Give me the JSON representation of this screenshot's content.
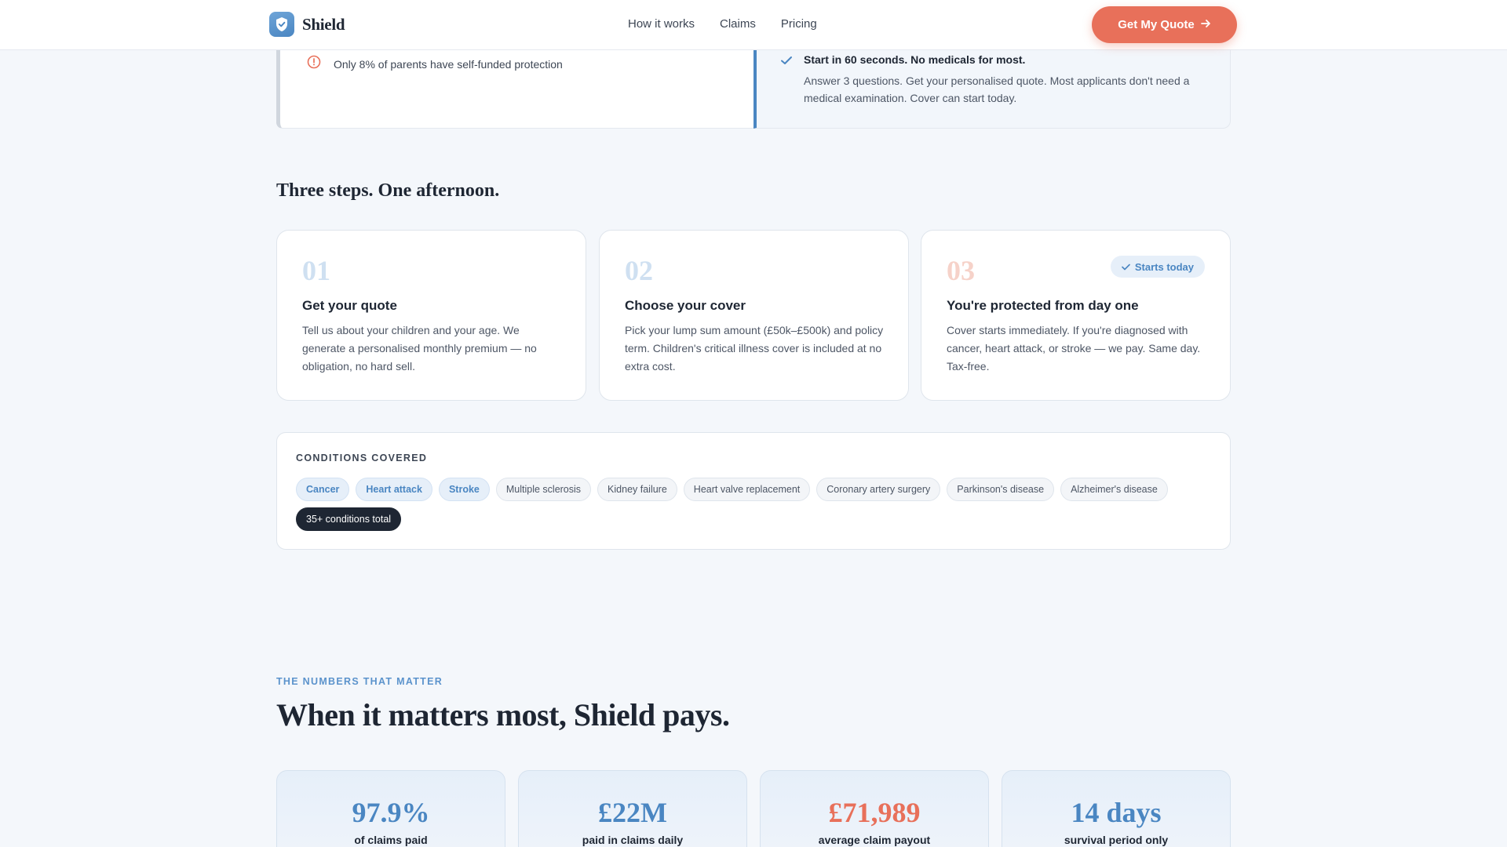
{
  "nav": {
    "brand": "Shield",
    "links": [
      "How it works",
      "Claims",
      "Pricing"
    ],
    "cta_label": "Get My Quote"
  },
  "top_cards": {
    "warning_text": "Only 8% of parents have self-funded protection",
    "check_title": "Start in 60 seconds. No medicals for most.",
    "check_desc": "Answer 3 questions. Get your personalised quote. Most applicants don't need a medical examination. Cover can start today."
  },
  "steps_section": {
    "title": "Three steps. One afternoon.",
    "steps": [
      {
        "num": "01",
        "title": "Get your quote",
        "desc": "Tell us about your children and your age. We generate a personalised monthly premium — no obligation, no hard sell."
      },
      {
        "num": "02",
        "title": "Choose your cover",
        "desc": "Pick your lump sum amount (£50k–£500k) and policy term. Children's critical illness cover is included at no extra cost."
      },
      {
        "num": "03",
        "title": "You're protected from day one",
        "desc": "Cover starts immediately. If you're diagnosed with cancer, heart attack, or stroke — we pay. Same day. Tax-free.",
        "badge": "Starts today"
      }
    ]
  },
  "conditions": {
    "label": "CONDITIONS COVERED",
    "chips": [
      "Cancer",
      "Heart attack",
      "Stroke",
      "Multiple sclerosis",
      "Kidney failure",
      "Heart valve replacement",
      "Coronary artery surgery",
      "Parkinson's disease",
      "Alzheimer's disease",
      "35+ conditions total"
    ]
  },
  "numbers": {
    "eyebrow": "THE NUMBERS THAT MATTER",
    "title": "When it matters most, Shield pays.",
    "stats": [
      {
        "value": "97.9%",
        "label": "of claims paid"
      },
      {
        "value": "£22M",
        "label": "paid in claims daily"
      },
      {
        "value": "£71,989",
        "label": "average claim payout"
      },
      {
        "value": "14 days",
        "label": "survival period only"
      }
    ]
  },
  "colors": {
    "accent": "#e8705a",
    "brand_blue": "#4a86c2",
    "dark": "#1e2633"
  }
}
